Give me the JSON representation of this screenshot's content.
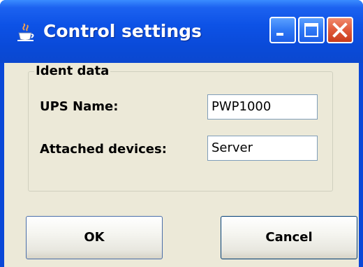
{
  "window": {
    "title": "Control settings",
    "icon": "java-cup-icon",
    "controls": [
      "minimize-icon",
      "maximize-icon",
      "close-icon"
    ]
  },
  "group": {
    "title": "Ident data"
  },
  "fields": {
    "ups_name_label": "UPS Name:",
    "ups_name_value": "PWP1000",
    "attached_label": "Attached devices:",
    "attached_value": "Server"
  },
  "buttons": {
    "ok_label": "OK",
    "cancel_label": "Cancel"
  },
  "colors": {
    "titlebar": "#0a4ad8",
    "client_bg": "#ece9d8",
    "close_button": "#e05a3a"
  }
}
